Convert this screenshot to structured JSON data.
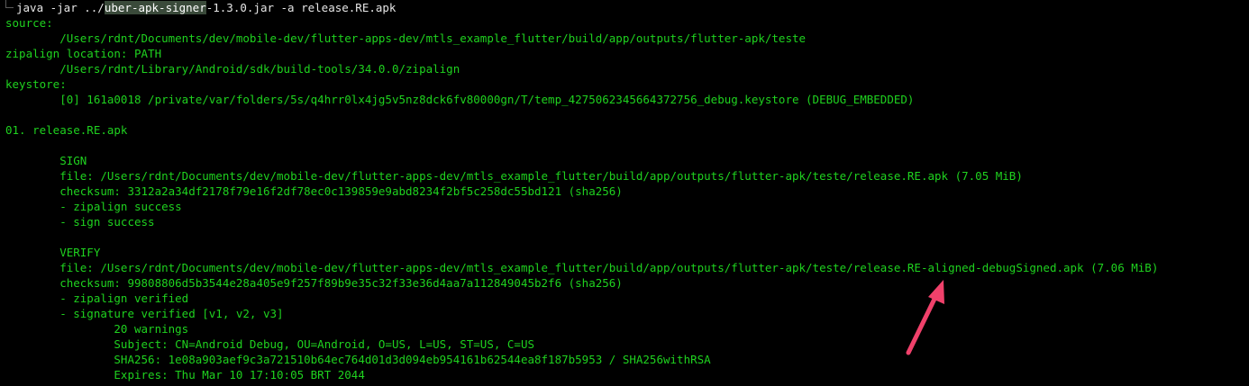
{
  "command": {
    "prefix": "java -jar ../",
    "highlighted": "uber-apk-signer",
    "suffix": "-1.3.0.jar -a release.RE.apk"
  },
  "output_lines": [
    "source:",
    "        /Users/rdnt/Documents/dev/mobile-dev/flutter-apps-dev/mtls_example_flutter/build/app/outputs/flutter-apk/teste",
    "zipalign location: PATH",
    "        /Users/rdnt/Library/Android/sdk/build-tools/34.0.0/zipalign",
    "keystore:",
    "        [0] 161a0018 /private/var/folders/5s/q4hrr0lx4jg5v5nz8dck6fv80000gn/T/temp_4275062345664372756_debug.keystore (DEBUG_EMBEDDED)",
    "",
    "01. release.RE.apk",
    "",
    "        SIGN",
    "        file: /Users/rdnt/Documents/dev/mobile-dev/flutter-apps-dev/mtls_example_flutter/build/app/outputs/flutter-apk/teste/release.RE.apk (7.05 MiB)",
    "        checksum: 3312a2a34df2178f79e16f2df78ec0c139859e9abd8234f2bf5c258dc55bd121 (sha256)",
    "        - zipalign success",
    "        - sign success",
    "",
    "        VERIFY",
    "        file: /Users/rdnt/Documents/dev/mobile-dev/flutter-apps-dev/mtls_example_flutter/build/app/outputs/flutter-apk/teste/release.RE-aligned-debugSigned.apk (7.06 MiB)",
    "        checksum: 99808806d5b3544e28a405e9f257f89b9e35c32f33e36d4aa7a112849045b2f6 (sha256)",
    "        - zipalign verified",
    "        - signature verified [v1, v2, v3]",
    "                20 warnings",
    "                Subject: CN=Android Debug, OU=Android, O=US, L=US, ST=US, C=US",
    "                SHA256: 1e08a903aef9c3a721510b64ec764d01d3d094eb954161b62544ea8f187b5953 / SHA256withRSA",
    "                Expires: Thu Mar 10 17:10:05 BRT 2044"
  ],
  "colors": {
    "background": "#000000",
    "text": "#1fd21f",
    "command": "#e6e6e6",
    "arrow": "#f0416b"
  },
  "annotation": {
    "icon": "arrow-icon"
  }
}
